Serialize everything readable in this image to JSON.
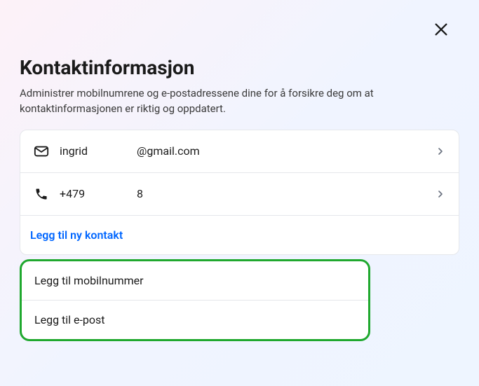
{
  "modal": {
    "title": "Kontaktinformasjon",
    "subtitle": "Administrer mobilnumrene og e-postadressene dine for å forsikre deg om at kontaktinformasjonen er riktig og oppdatert."
  },
  "contacts": {
    "email": {
      "part1": "ingrid",
      "part2": "@gmail.com"
    },
    "phone": {
      "part1": "+479",
      "part2": "8"
    }
  },
  "actions": {
    "add_contact": "Legg til ny kontakt",
    "add_phone": "Legg til mobilnummer",
    "add_email": "Legg til e-post"
  }
}
